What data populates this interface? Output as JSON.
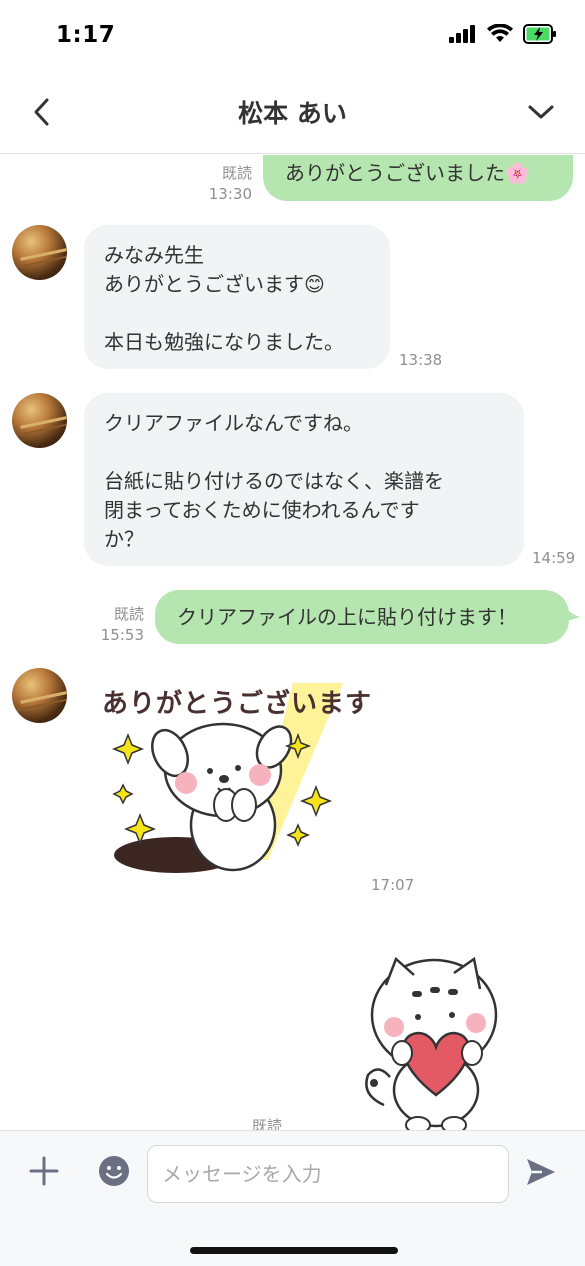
{
  "status_bar": {
    "time": "1:17"
  },
  "header": {
    "title": "松本 あい"
  },
  "messages": {
    "m1": {
      "text": "ありがとうございました🌸",
      "read": "既読",
      "time": "13:30"
    },
    "m2": {
      "text": "みなみ先生\nありがとうございます😊\n\n本日も勉強になりました。",
      "time": "13:38"
    },
    "m3": {
      "text": "クリアファイルなんですね。\n\n台紙に貼り付けるのではなく、楽譜を\n閉まっておくために使われるんです\nか？",
      "time": "14:59"
    },
    "m4": {
      "text": "クリアファイルの上に貼り付けます！",
      "read": "既読",
      "time": "15:53"
    },
    "m5": {
      "sticker_text": "ありがとうございます",
      "time": "17:07"
    },
    "m6": {
      "read": "既読"
    }
  },
  "input": {
    "placeholder": "メッセージを入力"
  },
  "colors": {
    "out_bubble": "#b6e6b0",
    "in_bubble": "#f2f3f5",
    "icon": "#6a7081"
  },
  "icons": [
    "back-icon",
    "chevron-down-icon",
    "plus-icon",
    "emoji-icon",
    "send-icon"
  ]
}
